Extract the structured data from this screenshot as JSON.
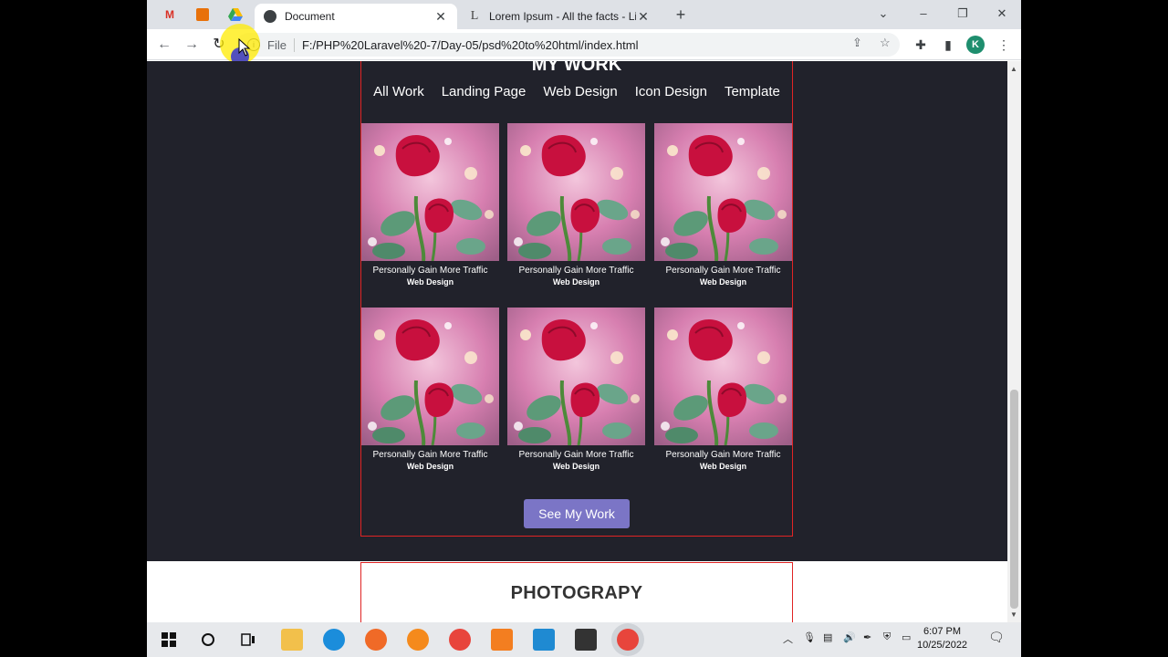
{
  "browser": {
    "tabs": [
      {
        "title": "Document",
        "active": true
      },
      {
        "title": "Lorem Ipsum - All the facts - Lip",
        "active": false
      }
    ],
    "omnibox": {
      "scheme_label": "File",
      "url": "F:/PHP%20Laravel%20-7/Day-05/psd%20to%20html/index.html"
    },
    "profile_initial": "K"
  },
  "page": {
    "work_title": "MY WORK",
    "filters": [
      "All Work",
      "Landing Page",
      "Web Design",
      "Icon Design",
      "Template"
    ],
    "items": [
      {
        "title": "Personally Gain More Traffic",
        "category": "Web Design"
      },
      {
        "title": "Personally Gain More Traffic",
        "category": "Web Design"
      },
      {
        "title": "Personally Gain More Traffic",
        "category": "Web Design"
      },
      {
        "title": "Personally Gain More Traffic",
        "category": "Web Design"
      },
      {
        "title": "Personally Gain More Traffic",
        "category": "Web Design"
      },
      {
        "title": "Personally Gain More Traffic",
        "category": "Web Design"
      }
    ],
    "cta_label": "See My Work",
    "next_section_title": "PHOTOGRAPY"
  },
  "taskbar": {
    "time": "6:07 PM",
    "date": "10/25/2022"
  },
  "colors": {
    "page_bg": "#21222b",
    "section_border": "#e02424",
    "button": "#7b75c6"
  }
}
